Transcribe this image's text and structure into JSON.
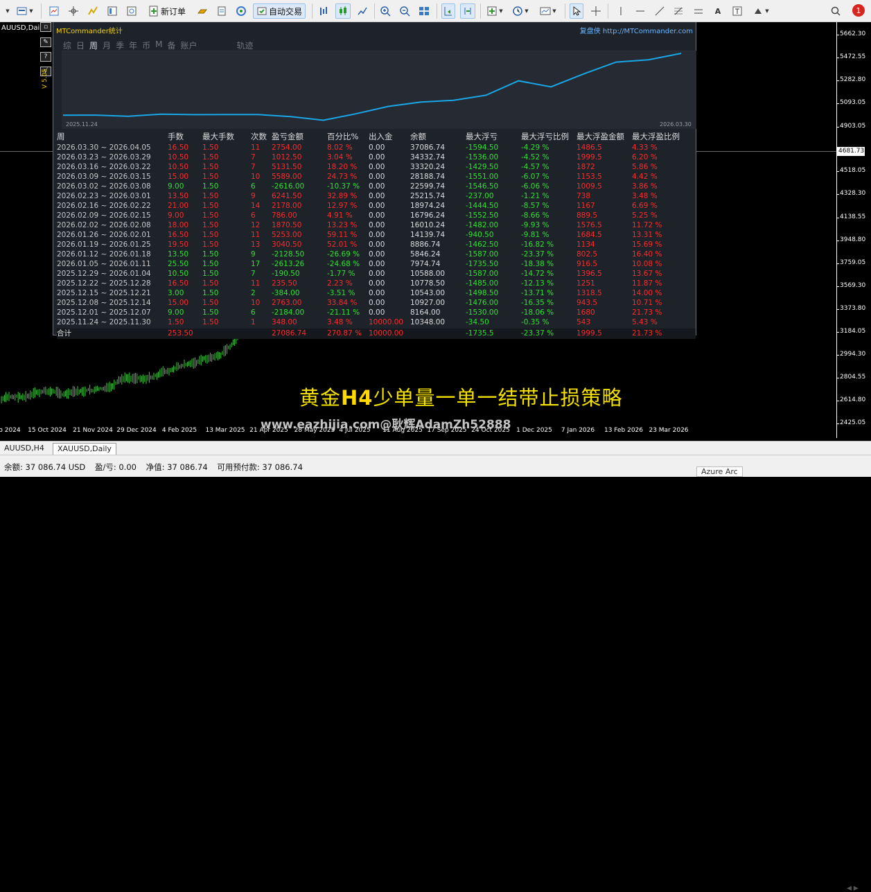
{
  "toolbar": {
    "new_order_label": "新订单",
    "auto_trading_label": "自动交易",
    "notification_count": "1"
  },
  "chart": {
    "symbol_label": "AUUSD,Daily",
    "price_label": "4681.73",
    "y_ticks": [
      "5662.30",
      "5472.55",
      "5282.80",
      "5093.05",
      "4903.05",
      "4518.05",
      "4328.30",
      "4138.55",
      "3948.80",
      "3759.05",
      "3569.30",
      "3373.80",
      "3184.05",
      "2994.30",
      "2804.55",
      "2614.80",
      "2425.05"
    ],
    "x_ticks": [
      "o 2024",
      "15 Oct 2024",
      "21 Nov 2024",
      "29 Dec 2024",
      "4 Feb 2025",
      "13 Mar 2025",
      "21 Apr 2025",
      "28 May 2025",
      "4 Jul 2025",
      "11 Aug 2025",
      "17 Sep 2025",
      "24 Oct 2025",
      "1 Dec 2025",
      "7 Jan 2026",
      "13 Feb 2026",
      "23 Mar 2026"
    ]
  },
  "panel": {
    "title": "MTCommander统计",
    "brand_name": "复盘侠",
    "brand_url": "http://MTCommander.com",
    "version": "V 5.05",
    "tabs": [
      "综",
      "日",
      "周",
      "月",
      "季",
      "年",
      "币",
      "M",
      "备",
      "账户",
      "轨迹"
    ],
    "active_tab": "周",
    "equity_start_date": "2025.11.24",
    "equity_end_date": "2026.03.30",
    "equity_curve": [
      10348,
      10360,
      9850,
      10778,
      10588,
      10640,
      10620,
      9700,
      8164,
      10927,
      14139,
      16010,
      16796,
      18974,
      25215,
      22599,
      28188,
      33320,
      34332,
      37086
    ],
    "headers": [
      "周",
      "手数",
      "最大手数",
      "次数",
      "盈亏金额",
      "百分比%",
      "出入金",
      "余额",
      "最大浮亏",
      "最大浮亏比例",
      "最大浮盈金额",
      "最大浮盈比例"
    ],
    "rows": [
      [
        "2026.03.30 ~ 2026.04.05",
        "16.50",
        "1.50",
        "11",
        "2754.00",
        "8.02 %",
        "0.00",
        "37086.74",
        "-1594.50",
        "-4.29 %",
        "1486.5",
        "4.33 %",
        "r"
      ],
      [
        "2026.03.23 ~ 2026.03.29",
        "10.50",
        "1.50",
        "7",
        "1012.50",
        "3.04 %",
        "0.00",
        "34332.74",
        "-1536.00",
        "-4.52 %",
        "1999.5",
        "6.20 %",
        "r"
      ],
      [
        "2026.03.16 ~ 2026.03.22",
        "10.50",
        "1.50",
        "7",
        "5131.50",
        "18.20 %",
        "0.00",
        "33320.24",
        "-1429.50",
        "-4.57 %",
        "1872",
        "5.86 %",
        "r"
      ],
      [
        "2026.03.09 ~ 2026.03.15",
        "15.00",
        "1.50",
        "10",
        "5589.00",
        "24.73 %",
        "0.00",
        "28188.74",
        "-1551.00",
        "-6.07 %",
        "1153.5",
        "4.42 %",
        "r"
      ],
      [
        "2026.03.02 ~ 2026.03.08",
        "9.00",
        "1.50",
        "6",
        "-2616.00",
        "-10.37 %",
        "0.00",
        "22599.74",
        "-1546.50",
        "-6.06 %",
        "1009.5",
        "3.86 %",
        "g"
      ],
      [
        "2026.02.23 ~ 2026.03.01",
        "13.50",
        "1.50",
        "9",
        "6241.50",
        "32.89 %",
        "0.00",
        "25215.74",
        "-237.00",
        "-1.21 %",
        "738",
        "3.48 %",
        "r"
      ],
      [
        "2026.02.16 ~ 2026.02.22",
        "21.00",
        "1.50",
        "14",
        "2178.00",
        "12.97 %",
        "0.00",
        "18974.24",
        "-1444.50",
        "-8.57 %",
        "1167",
        "6.69 %",
        "r"
      ],
      [
        "2026.02.09 ~ 2026.02.15",
        "9.00",
        "1.50",
        "6",
        "786.00",
        "4.91 %",
        "0.00",
        "16796.24",
        "-1552.50",
        "-8.66 %",
        "889.5",
        "5.25 %",
        "r"
      ],
      [
        "2026.02.02 ~ 2026.02.08",
        "18.00",
        "1.50",
        "12",
        "1870.50",
        "13.23 %",
        "0.00",
        "16010.24",
        "-1482.00",
        "-9.93 %",
        "1576.5",
        "11.72 %",
        "r"
      ],
      [
        "2026.01.26 ~ 2026.02.01",
        "16.50",
        "1.50",
        "11",
        "5253.00",
        "59.11 %",
        "0.00",
        "14139.74",
        "-940.50",
        "-9.81 %",
        "1684.5",
        "13.31 %",
        "r"
      ],
      [
        "2026.01.19 ~ 2026.01.25",
        "19.50",
        "1.50",
        "13",
        "3040.50",
        "52.01 %",
        "0.00",
        "8886.74",
        "-1462.50",
        "-16.82 %",
        "1134",
        "15.69 %",
        "r"
      ],
      [
        "2026.01.12 ~ 2026.01.18",
        "13.50",
        "1.50",
        "9",
        "-2128.50",
        "-26.69 %",
        "0.00",
        "5846.24",
        "-1587.00",
        "-23.37 %",
        "802.5",
        "16.40 %",
        "g"
      ],
      [
        "2026.01.05 ~ 2026.01.11",
        "25.50",
        "1.50",
        "17",
        "-2613.26",
        "-24.68 %",
        "0.00",
        "7974.74",
        "-1735.50",
        "-18.38 %",
        "916.5",
        "10.08 %",
        "g"
      ],
      [
        "2025.12.29 ~ 2026.01.04",
        "10.50",
        "1.50",
        "7",
        "-190.50",
        "-1.77 %",
        "0.00",
        "10588.00",
        "-1587.00",
        "-14.72 %",
        "1396.5",
        "13.67 %",
        "g"
      ],
      [
        "2025.12.22 ~ 2025.12.28",
        "16.50",
        "1.50",
        "11",
        "235.50",
        "2.23 %",
        "0.00",
        "10778.50",
        "-1485.00",
        "-12.13 %",
        "1251",
        "11.87 %",
        "r"
      ],
      [
        "2025.12.15 ~ 2025.12.21",
        "3.00",
        "1.50",
        "2",
        "-384.00",
        "-3.51 %",
        "0.00",
        "10543.00",
        "-1498.50",
        "-13.71 %",
        "1318.5",
        "14.00 %",
        "g"
      ],
      [
        "2025.12.08 ~ 2025.12.14",
        "15.00",
        "1.50",
        "10",
        "2763.00",
        "33.84 %",
        "0.00",
        "10927.00",
        "-1476.00",
        "-16.35 %",
        "943.5",
        "10.71 %",
        "r"
      ],
      [
        "2025.12.01 ~ 2025.12.07",
        "9.00",
        "1.50",
        "6",
        "-2184.00",
        "-21.11 %",
        "0.00",
        "8164.00",
        "-1530.00",
        "-18.06 %",
        "1680",
        "21.73 %",
        "g"
      ],
      [
        "2025.11.24 ~ 2025.11.30",
        "1.50",
        "1.50",
        "1",
        "348.00",
        "3.48 %",
        "10000.00",
        "10348.00",
        "-34.50",
        "-0.35 %",
        "543",
        "5.43 %",
        "r"
      ]
    ],
    "total": {
      "label": "合计",
      "lots": "253.50",
      "pnl": "27086.74",
      "pct": "270.87 %",
      "deposit": "10000.00",
      "max_dd": "-1735.5",
      "max_dd_pct": "-23.37 %",
      "max_fp": "1999.5",
      "max_fp_pct": "21.73 %"
    }
  },
  "caption": {
    "pre": "黄金",
    "bold": "H4",
    "post": "少单量一单一结带止损策略"
  },
  "watermark": "www.eazhijia.com@耿辉AdamZh52888",
  "symbol_tabs": [
    "AUUSD,H4",
    "XAUUSD,Daily"
  ],
  "status": {
    "balance": "余额: 37 086.74 USD",
    "profit": "盈/亏: 0.00",
    "equity": "净值: 37 086.74",
    "free_margin": "可用预付款: 37 086.74"
  },
  "taskbar_label": "Azure Arc"
}
